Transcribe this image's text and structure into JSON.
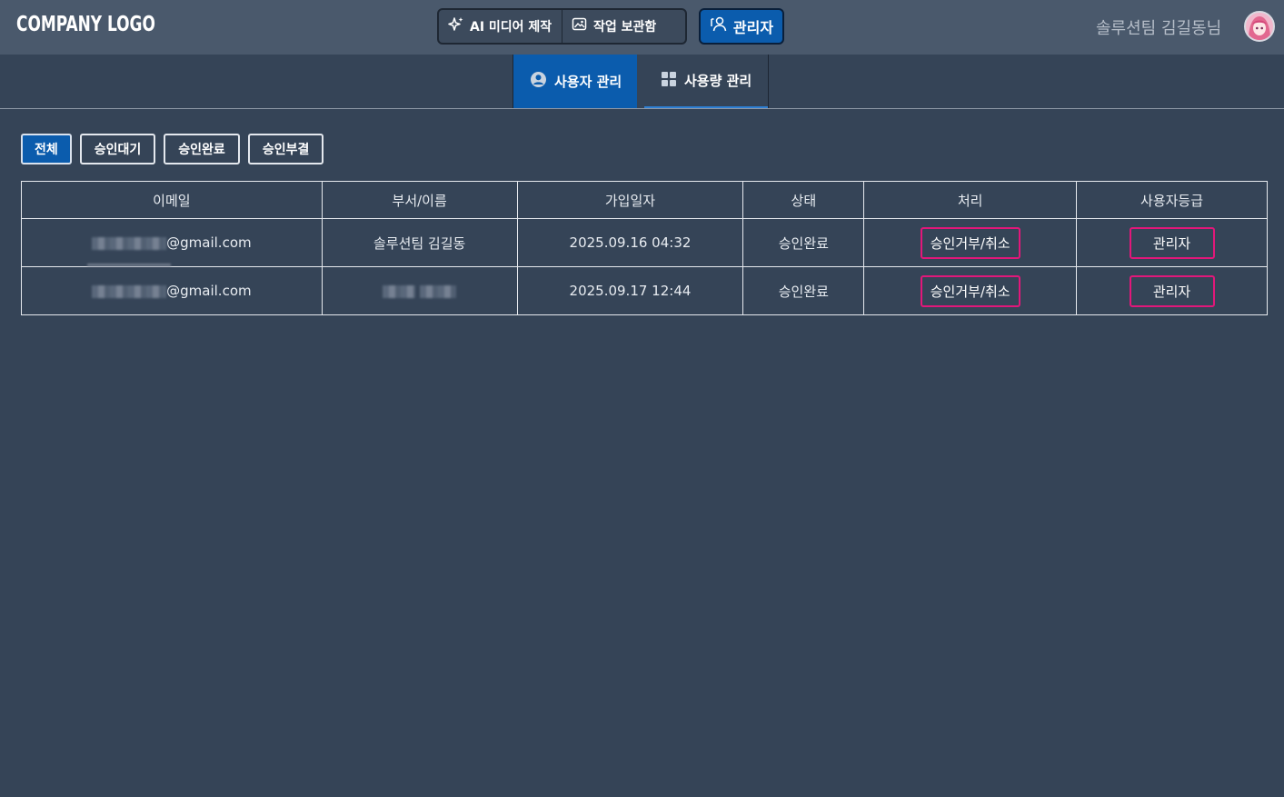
{
  "header": {
    "logo": "COMPANY LOGO",
    "nav": [
      {
        "label": "AI 미디어 제작",
        "icon": "sparkle-icon"
      },
      {
        "label": "작업 보관함",
        "icon": "image-library-icon"
      }
    ],
    "admin_label": "관리자",
    "admin_icon": "admin-user-icon",
    "user_name": "솔루션팀 김길동님"
  },
  "subtabs": [
    {
      "label": "사용자 관리",
      "icon": "user-circle-icon",
      "active": true
    },
    {
      "label": "사용량 관리",
      "icon": "grid-icon",
      "active": false
    }
  ],
  "filters": [
    "전체",
    "승인대기",
    "승인완료",
    "승인부결"
  ],
  "table": {
    "columns": [
      "이메일",
      "부서/이름",
      "가입일자",
      "상태",
      "처리",
      "사용자등급"
    ],
    "rows": [
      {
        "email_suffix": "@gmail.com",
        "dept_name": "솔루션팀 김길동",
        "joined": "2025.09.16 04:32",
        "status": "승인완료",
        "action": "승인거부/취소",
        "grade": "관리자"
      },
      {
        "email_suffix": "@gmail.com",
        "dept_name": "",
        "joined": "2025.09.17 12:44",
        "status": "승인완료",
        "action": "승인거부/취소",
        "grade": "관리자"
      }
    ]
  },
  "colors": {
    "background": "#354457",
    "header": "#4a596c",
    "accent": "#0b5cad",
    "status_ok": "#b9e27a",
    "action_border": "#e2177a"
  }
}
